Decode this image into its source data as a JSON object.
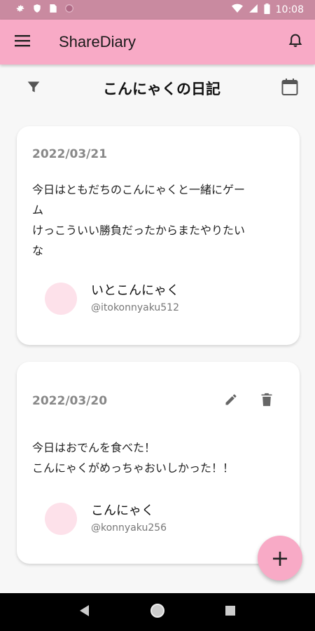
{
  "status_bar": {
    "time": "10:08",
    "left_icons": [
      "gear-icon",
      "shield-icon",
      "sim-card-icon",
      "circle-icon"
    ],
    "right_icons": [
      "wifi-icon",
      "signal-icon",
      "battery-icon"
    ]
  },
  "app_bar": {
    "title": "ShareDiary",
    "menu_icon": "menu-icon",
    "notification_icon": "bell-icon",
    "color": "#f8aac6"
  },
  "sub_header": {
    "title": "こんにゃくの日記",
    "filter_icon": "filter-icon",
    "calendar_icon": "calendar-icon"
  },
  "entries": [
    {
      "date": "2022/03/21",
      "body": "今日はともだちのこんにゃくと一緒にゲー\nム\nけっこういい勝負だったからまたやりたい\nな",
      "author_name": "いとこんにゃく",
      "author_handle": "@itokonnyaku512",
      "editable": false
    },
    {
      "date": "2022/03/20",
      "body": "今日はおでんを食べた！\nこんにゃくがめっちゃおいしかった！！",
      "author_name": "こんにゃく",
      "author_handle": "@konnyaku256",
      "editable": true
    }
  ],
  "fab": {
    "label": "+",
    "color": "#f8aac6"
  },
  "nav_bar": {
    "icons": [
      "back-icon",
      "home-icon",
      "recents-icon"
    ]
  }
}
